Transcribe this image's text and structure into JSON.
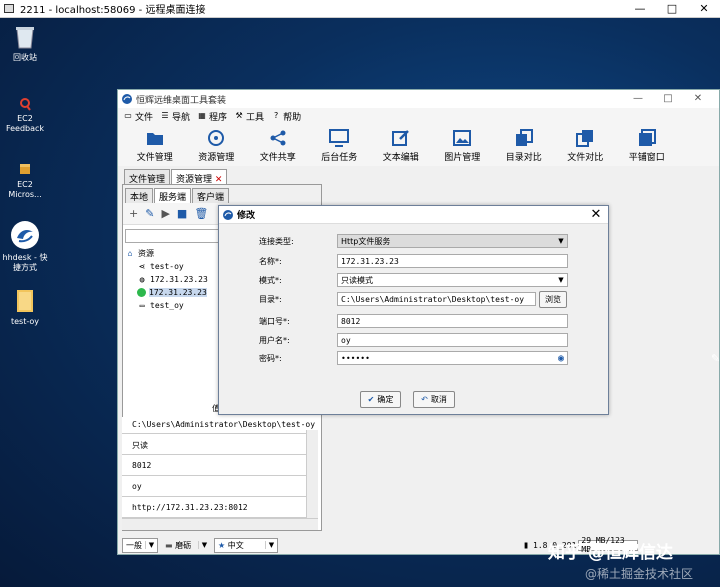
{
  "rdp": {
    "title": "2211 - localhost:58069 - 远程桌面连接",
    "min": "—",
    "max": "□",
    "close": "✕"
  },
  "desktop_icons": [
    {
      "label_line1": "回收站",
      "label_line2": "",
      "icon": "recycle-bin-icon"
    },
    {
      "label_line1": "EC2",
      "label_line2": "Feedback",
      "icon": "feedback-icon"
    },
    {
      "label_line1": "EC2",
      "label_line2": "Micros...",
      "icon": "package-icon"
    },
    {
      "label_line1": "hhdesk - 快",
      "label_line2": "捷方式",
      "icon": "hhdesk-shortcut-icon"
    },
    {
      "label_line1": "test-oy",
      "label_line2": "",
      "icon": "folder-icon"
    }
  ],
  "app": {
    "title": "恒辉远维桌面工具套装",
    "menu": [
      "文件",
      "导航",
      "程序",
      "工具",
      "帮助"
    ],
    "toolbar": [
      "文件管理",
      "资源管理",
      "文件共享",
      "后台任务",
      "文本编辑",
      "图片管理",
      "目录对比",
      "文件对比",
      "平铺窗口"
    ],
    "main_tabs": [
      "文件管理",
      "资源管理"
    ],
    "main_tab_close": "✕",
    "sub_tabs": [
      "本地",
      "服务端",
      "客户端"
    ],
    "tree": {
      "root": "资源",
      "children": [
        "test-oy",
        "172.31.23.23",
        "172.31.23.23",
        "test_oy"
      ]
    },
    "props": {
      "header": "值",
      "rows": [
        "C:\\Users\\Administrator\\Desktop\\test-oy",
        "只读",
        "8012",
        "oy",
        "http://172.31.23.23:8012"
      ]
    },
    "status": {
      "mode": "一般",
      "key": "磨砺",
      "lang": "中文",
      "version": "1.8.0_291",
      "memory": "29 MB/123 MB"
    }
  },
  "dialog": {
    "title": "修改",
    "close": "✕",
    "fields": {
      "type_label": "连接类型:",
      "type_value": "Http文件服务",
      "name_label": "名称*:",
      "name_value": "172.31.23.23",
      "mode_label": "模式*:",
      "mode_value": "只读模式",
      "dir_label": "目录*:",
      "dir_value": "C:\\Users\\Administrator\\Desktop\\test-oy",
      "browse": "浏览",
      "port_label": "端口号*:",
      "port_value": "8012",
      "user_label": "用户名*:",
      "user_value": "oy",
      "pwd_label": "密码*:",
      "pwd_value": "••••••"
    },
    "ok": "确定",
    "cancel": "取消"
  },
  "watermark": {
    "line1": "知乎 @恒辉信达",
    "line2": "@稀土掘金技术社区"
  },
  "colors": {
    "accent": "#1e5aa8",
    "dialog_border": "#6d7f99",
    "desktop_bg": "#0a2f5e"
  }
}
